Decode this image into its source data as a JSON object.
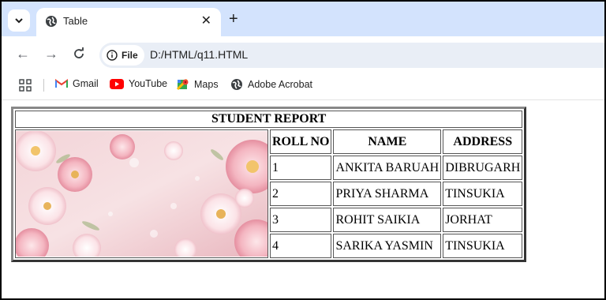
{
  "browser": {
    "tab_title": "Table",
    "address_chip": "File",
    "url": "D:/HTML/q11.HTML"
  },
  "bookmarks": [
    {
      "label": "Gmail",
      "icon": "gmail-icon"
    },
    {
      "label": "YouTube",
      "icon": "youtube-icon"
    },
    {
      "label": "Maps",
      "icon": "maps-icon"
    },
    {
      "label": "Adobe Acrobat",
      "icon": "globe-icon"
    }
  ],
  "table": {
    "caption": "STUDENT REPORT",
    "headers": [
      "ROLL NO",
      "NAME",
      "ADDRESS"
    ],
    "rows": [
      [
        "1",
        "ANKITA BARUAH",
        "DIBRUGARH"
      ],
      [
        "2",
        "PRIYA SHARMA",
        "TINSUKIA"
      ],
      [
        "3",
        "ROHIT SAIKIA",
        "JORHAT"
      ],
      [
        "4",
        "SARIKA YASMIN",
        "TINSUKIA"
      ]
    ],
    "image": "pink-flowers-image"
  },
  "colors": {
    "tabstrip": "#d3e3fd",
    "omnibox": "#e9eef6",
    "youtube_red": "#ff0000"
  }
}
